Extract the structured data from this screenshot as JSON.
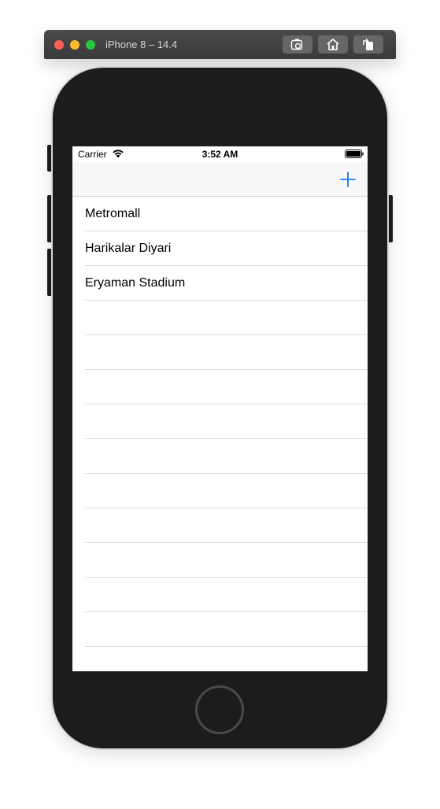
{
  "window": {
    "title": "iPhone 8 – 14.4",
    "buttons": [
      "screenshot-icon",
      "home-icon",
      "rotate-icon"
    ]
  },
  "status_bar": {
    "carrier": "Carrier",
    "time": "3:52 AM",
    "icons": [
      "wifi-icon",
      "battery-icon"
    ]
  },
  "nav_bar": {
    "add_icon": "plus-icon",
    "accent_color": "#0a7aff"
  },
  "table": {
    "rows": [
      {
        "label": "Metromall"
      },
      {
        "label": "Harikalar Diyari"
      },
      {
        "label": "Eryaman Stadium"
      },
      {
        "label": ""
      },
      {
        "label": ""
      },
      {
        "label": ""
      },
      {
        "label": ""
      },
      {
        "label": ""
      },
      {
        "label": ""
      },
      {
        "label": ""
      },
      {
        "label": ""
      },
      {
        "label": ""
      },
      {
        "label": ""
      }
    ]
  }
}
